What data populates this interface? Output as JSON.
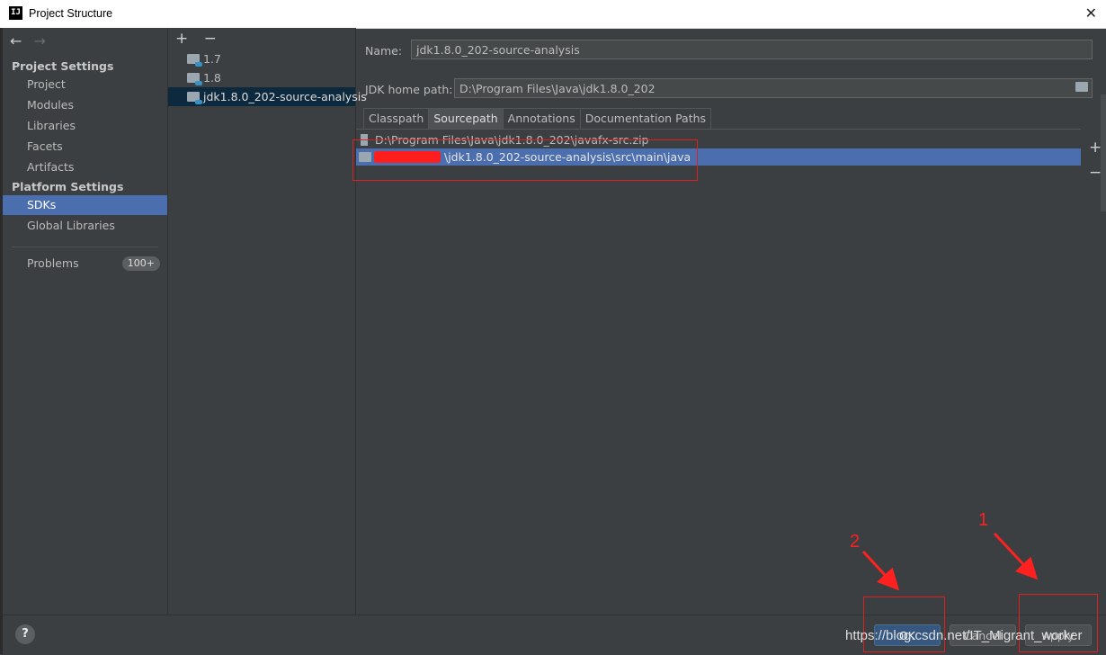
{
  "window": {
    "title": "Project Structure",
    "logo": "IJ",
    "close": "✕"
  },
  "nav": {
    "back": "←",
    "forward": "→"
  },
  "sidebar": {
    "project_settings_header": "Project Settings",
    "project_items": [
      {
        "label": "Project"
      },
      {
        "label": "Modules"
      },
      {
        "label": "Libraries"
      },
      {
        "label": "Facets"
      },
      {
        "label": "Artifacts"
      }
    ],
    "platform_settings_header": "Platform Settings",
    "platform_items": [
      {
        "label": "SDKs"
      },
      {
        "label": "Global Libraries"
      }
    ],
    "problems": {
      "label": "Problems",
      "badge": "100+"
    }
  },
  "sdk_list": {
    "add": "+",
    "remove": "−",
    "items": [
      {
        "label": "1.7"
      },
      {
        "label": "1.8"
      },
      {
        "label": "jdk1.8.0_202-source-analysis"
      }
    ]
  },
  "detail": {
    "name_label": "Name:",
    "name_value": "jdk1.8.0_202-source-analysis",
    "home_label": "JDK home path:",
    "home_value": "D:\\Program Files\\Java\\jdk1.8.0_202",
    "tabs": [
      {
        "label": "Classpath"
      },
      {
        "label": "Sourcepath"
      },
      {
        "label": "Annotations"
      },
      {
        "label": "Documentation Paths"
      }
    ],
    "active_tab": "Sourcepath",
    "paths": [
      {
        "text": "D:\\Program Files\\Java\\jdk1.8.0_202\\javafx-src.zip"
      },
      {
        "text": "\\jdk1.8.0_202-source-analysis\\src\\main\\java"
      }
    ],
    "side_add": "+",
    "side_remove": "−"
  },
  "footer": {
    "help": "?",
    "ok": "OK",
    "cancel": "Cancel",
    "apply": "Apply"
  },
  "annotations": {
    "mark1": "1",
    "mark2": "2"
  },
  "watermark": "https://blog.csdn.net/IT_Migrant_worker",
  "colors": {
    "selection": "#4b6eaf",
    "annotation_red": "#ff2020",
    "primary_button": "#365880"
  }
}
